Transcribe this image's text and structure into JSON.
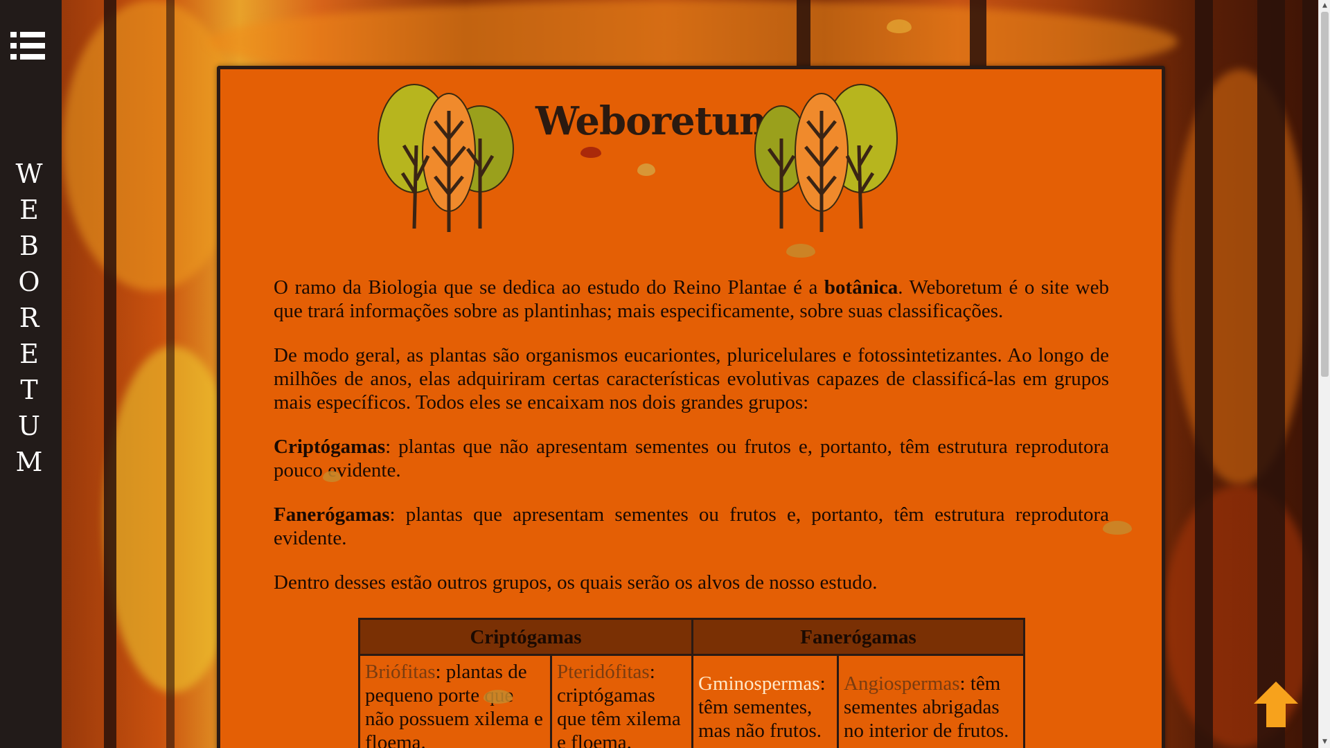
{
  "sidebar": {
    "menu_icon": "list-icon",
    "title_letters": [
      "W",
      "E",
      "B",
      "O",
      "R",
      "E",
      "T",
      "U",
      "M"
    ]
  },
  "header": {
    "site_title": "Weboretum"
  },
  "content": {
    "p1_before": "O ramo da Biologia que se dedica ao estudo do Reino Plantae é a ",
    "p1_bold": "botânica",
    "p1_after": ". Weboretum é o site web que trará informações sobre as plantinhas; mais especificamente, sobre suas classificações.",
    "p2": "De modo geral, as plantas são organismos eucariontes, pluricelulares e fotossintetizantes. Ao longo de milhões de anos, elas adquiriram certas características evolutivas capazes de classificá-las em grupos mais específicos. Todos eles se encaixam nos dois grandes grupos:",
    "p3_bold": "Criptógamas",
    "p3_rest": ": plantas que não apresentam sementes ou frutos e, portanto, têm estrutura reprodutora pouco evidente.",
    "p4_bold": "Fanerógamas",
    "p4_rest": ": plantas que apresentam sementes ou frutos e, portanto, têm estrutura reprodutora evidente.",
    "p5": "Dentro desses estão outros grupos, os quais serão os alvos de nosso estudo."
  },
  "table": {
    "headers": [
      "Criptógamas",
      "Fanerógamas"
    ],
    "cells": [
      {
        "term": "Briófitas",
        "desc": ": plantas de pequeno porte que não possuem xilema e floema."
      },
      {
        "term": "Pteridófitas",
        "desc": ": criptógamas que têm xilema e floema."
      },
      {
        "term": "Gminospermas",
        "desc": ": têm sementes, mas não frutos."
      },
      {
        "term": "Angiospermas",
        "desc": ": têm sementes abrigadas no interior de frutos."
      }
    ]
  },
  "colors": {
    "card": "#e45f05",
    "sidebar": "#221b19",
    "table_header": "#7a3004",
    "back_to_top": "#f7a21c"
  },
  "icons": {
    "back_to_top": "arrow-up-icon"
  }
}
